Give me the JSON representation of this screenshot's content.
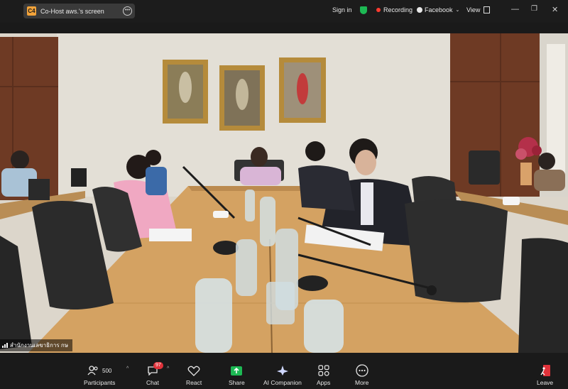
{
  "top_bar": {
    "share_badge": "C4",
    "share_label": "Co-Host aws.'s screen",
    "more_icon": "more-horizontal-icon",
    "sign_in": "Sign in",
    "recording": "Recording",
    "facebook": "Facebook",
    "view": "View",
    "colors": {
      "bar": "#1c1c1c",
      "security": "#1db954",
      "recording_dot": "#ff3b30",
      "badge": "#f2a33a"
    }
  },
  "video": {
    "speaker_label": "สำนักงานเลขาธิการ กษ",
    "content": "Live video feed: meeting room with board table"
  },
  "bottom_bar": {
    "participants_count": "500",
    "participants_label": "Participants",
    "chat_badge": "97",
    "chat_label": "Chat",
    "react_label": "React",
    "share_label": "Share",
    "ai_label": "AI Companion",
    "apps_label": "Apps",
    "more_label": "More",
    "leave_label": "Leave",
    "colors": {
      "share_icon": "#1db954",
      "chat_badge": "#e0323a",
      "leave_icon": "#e0323a"
    }
  }
}
